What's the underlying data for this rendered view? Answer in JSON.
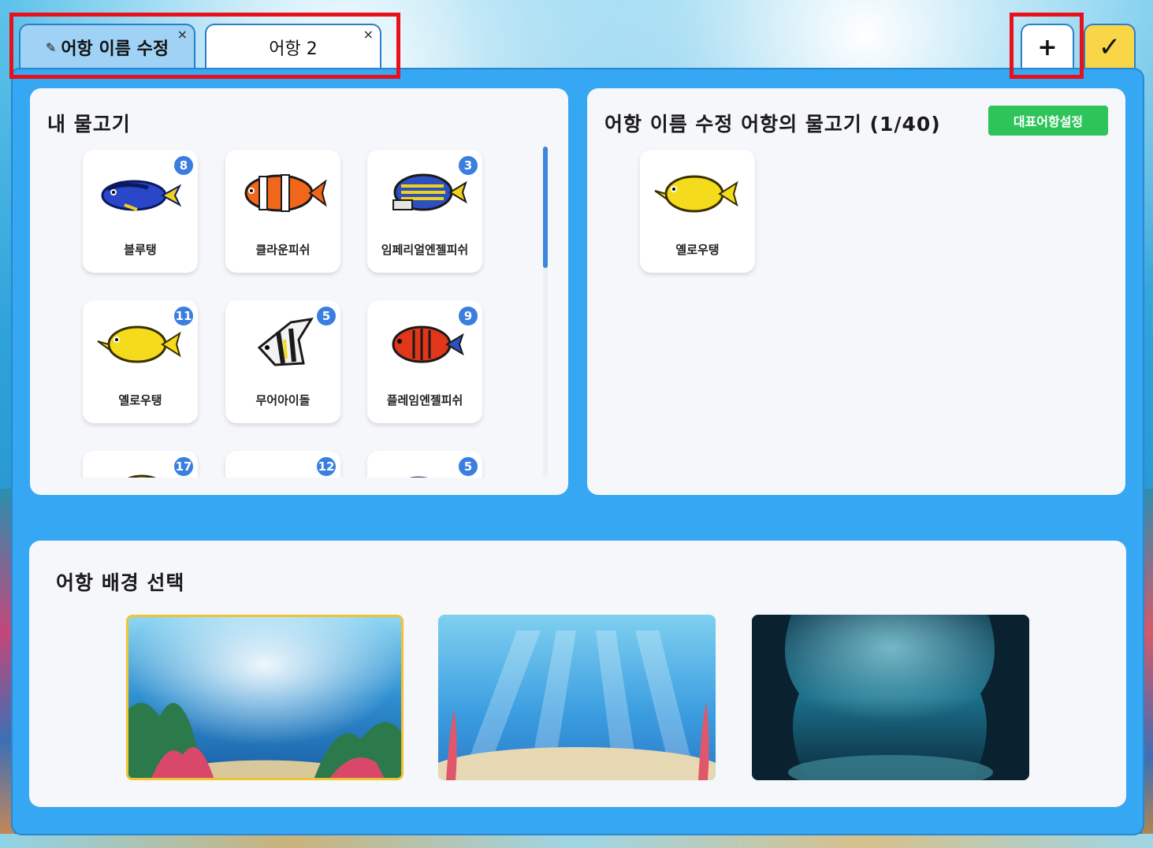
{
  "tabs": [
    {
      "label": "어항 이름 수정",
      "icon": "pencil-icon",
      "close": "×",
      "active": true
    },
    {
      "label": "어항 2",
      "close": "×",
      "active": false
    }
  ],
  "toolbar": {
    "add_label": "+",
    "confirm_label": "✓"
  },
  "my_fish": {
    "title": "내 물고기",
    "items": [
      {
        "name": "블루탱",
        "count": "8"
      },
      {
        "name": "클라운피쉬",
        "count": ""
      },
      {
        "name": "임페리얼엔젤피쉬",
        "count": "3"
      },
      {
        "name": "옐로우탱",
        "count": "11"
      },
      {
        "name": "무어아이돌",
        "count": "5"
      },
      {
        "name": "플레임엔젤피쉬",
        "count": "9"
      },
      {
        "name": "",
        "count": "17"
      },
      {
        "name": "",
        "count": "12"
      },
      {
        "name": "",
        "count": "5"
      }
    ]
  },
  "aquarium": {
    "title": "어항 이름 수정 어항의 물고기 (1/40)",
    "set_rep_label": "대표어항설정",
    "fish": [
      {
        "name": "옐로우탱"
      }
    ]
  },
  "background": {
    "title": "어항 배경 선택",
    "options": [
      {
        "name": "sunlit-reef",
        "selected": true
      },
      {
        "name": "light-rays-sandy",
        "selected": false
      },
      {
        "name": "deep-cave",
        "selected": false
      }
    ]
  },
  "colors": {
    "panel": "#36a7f3",
    "badge": "#3a7ee0",
    "rep_button": "#2fc45a",
    "confirm": "#f9d648",
    "highlight": "#e8101a"
  }
}
